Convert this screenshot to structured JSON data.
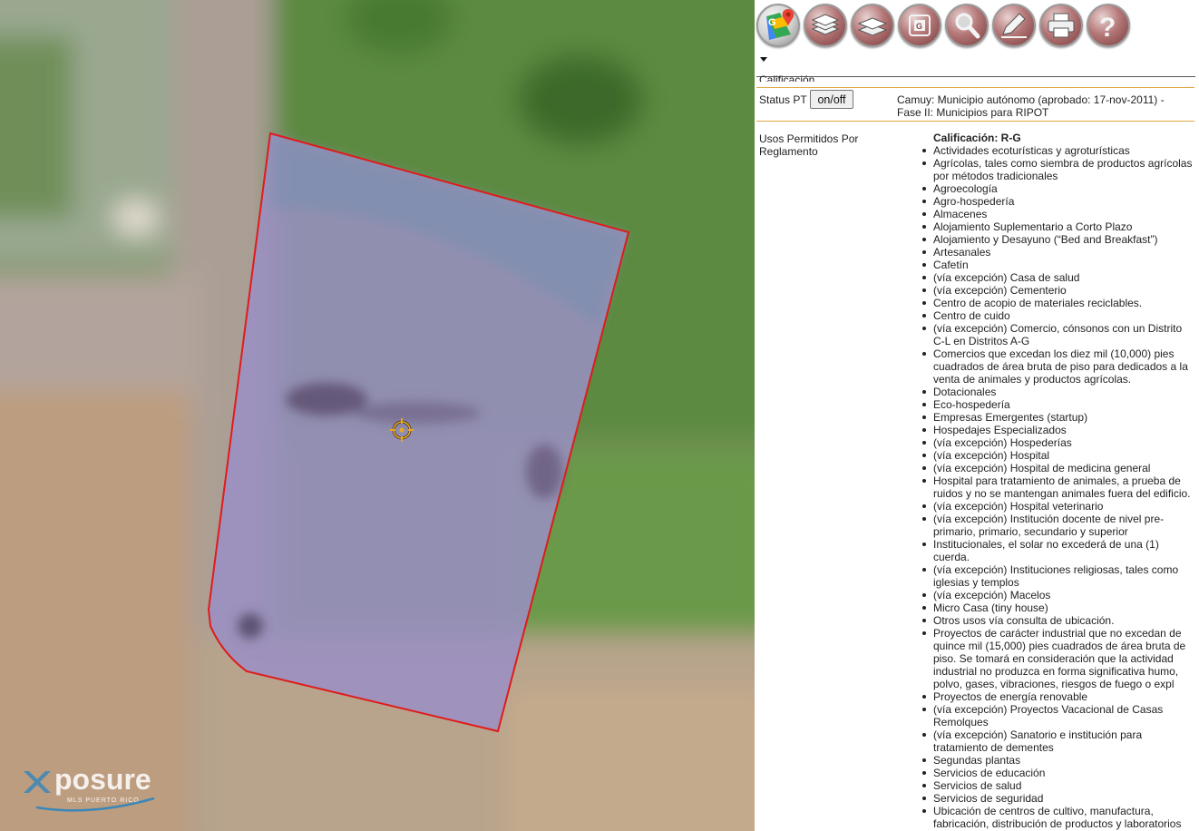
{
  "map": {
    "watermark": "posure",
    "watermark_sub": "MLS PUERTO RICO",
    "colors": {
      "parcel_border": "#e01b1b",
      "parcel_fill": "#9a8fc4",
      "grass": "#5f8a47",
      "soil": "#b49a84"
    }
  },
  "toolbar": {
    "icons": [
      {
        "name": "google-maps-icon"
      },
      {
        "name": "layers-icon"
      },
      {
        "name": "layers-alt-icon"
      },
      {
        "name": "geo-info-icon"
      },
      {
        "name": "search-icon"
      },
      {
        "name": "edit-icon"
      },
      {
        "name": "print-icon"
      },
      {
        "name": "help-icon"
      }
    ]
  },
  "panel": {
    "cut_label": "Calificación",
    "status_label": "Status PT",
    "toggle_label": "on/off",
    "status_value_line1": "Camuy: Municipio autónomo (aprobado: 17-nov-2011) -",
    "status_value_line2": "Fase II: Municipios para RIPOT",
    "usos_label_line1": "Usos Permitidos Por",
    "usos_label_line2": "Reglamento",
    "calificacion_title": "Calificación: R-G",
    "usos": [
      [
        "Actividades ecoturísticas y agroturísticas"
      ],
      [
        "Agrícolas, tales como siembra de productos agrícolas",
        "por métodos tradicionales"
      ],
      [
        "Agroecología"
      ],
      [
        "Agro-hospedería"
      ],
      [
        "Almacenes"
      ],
      [
        "Alojamiento Suplementario a Corto Plazo"
      ],
      [
        "Alojamiento y Desayuno (“Bed and Breakfast”)"
      ],
      [
        "Artesanales"
      ],
      [
        "Cafetín"
      ],
      [
        "(vía excepción) Casa de salud"
      ],
      [
        "(vía excepción) Cementerio"
      ],
      [
        "Centro de acopio de materiales reciclables."
      ],
      [
        "Centro de cuido"
      ],
      [
        "(vía excepción) Comercio, cónsonos con un Distrito",
        "C-L en Distritos A-G"
      ],
      [
        "Comercios que excedan los diez mil (10,000) pies",
        "cuadrados de área bruta de piso para dedicados a la",
        "venta de animales y productos agrícolas."
      ],
      [
        "Dotacionales"
      ],
      [
        "Eco-hospedería"
      ],
      [
        "Empresas Emergentes (startup)"
      ],
      [
        "Hospedajes Especializados"
      ],
      [
        "(vía excepción) Hospederías"
      ],
      [
        "(vía excepción) Hospital"
      ],
      [
        "(vía excepción) Hospital de medicina general"
      ],
      [
        "Hospital para tratamiento de animales, a prueba de",
        "ruidos y no se mantengan animales fuera del edificio."
      ],
      [
        "(vía excepción) Hospital veterinario"
      ],
      [
        "(vía excepción) Institución docente de nivel pre-",
        "primario, primario, secundario y superior"
      ],
      [
        "Institucionales, el solar no excederá de una (1)",
        "cuerda."
      ],
      [
        "(vía excepción) Instituciones religiosas, tales como",
        "iglesias y templos"
      ],
      [
        "(vía excepción) Macelos"
      ],
      [
        "Micro Casa (tiny house)"
      ],
      [
        "Otros usos vía consulta de ubicación."
      ],
      [
        "Proyectos de carácter industrial que no excedan de",
        "quince mil (15,000) pies cuadrados de área bruta de",
        "piso. Se tomará en consideración que la actividad",
        "industrial no produzca en forma significativa humo,",
        "polvo, gases, vibraciones, riesgos de fuego o expl"
      ],
      [
        "Proyectos de energía renovable"
      ],
      [
        "(vía excepción) Proyectos Vacacional de Casas",
        "Remolques"
      ],
      [
        "(vía excepción) Sanatorio e institución para",
        "tratamiento de dementes"
      ],
      [
        "Segundas plantas"
      ],
      [
        "Servicios de educación"
      ],
      [
        "Servicios de salud"
      ],
      [
        "Servicios de seguridad"
      ],
      [
        "Ubicación de centros de cultivo, manufactura,",
        "fabricación, distribución de productos y laboratorios"
      ]
    ]
  }
}
